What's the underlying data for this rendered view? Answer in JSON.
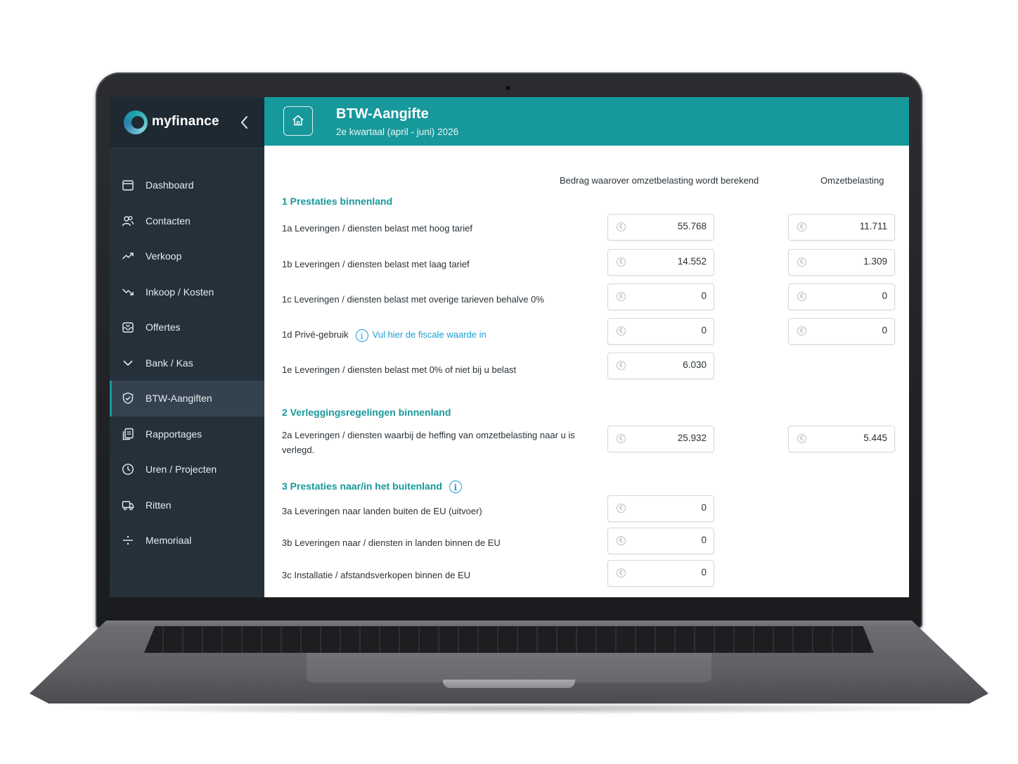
{
  "app": {
    "brand": "myfinance"
  },
  "sidebar": {
    "items": [
      {
        "label": "Dashboard",
        "icon": "calendar-icon"
      },
      {
        "label": "Contacten",
        "icon": "users-icon"
      },
      {
        "label": "Verkoop",
        "icon": "trend-up-icon"
      },
      {
        "label": "Inkoop / Kosten",
        "icon": "trend-down-icon"
      },
      {
        "label": "Offertes",
        "icon": "inbox-icon"
      },
      {
        "label": "Bank / Kas",
        "icon": "chevron-down-icon"
      },
      {
        "label": "BTW-Aangiften",
        "icon": "shield-icon",
        "active": true
      },
      {
        "label": "Rapportages",
        "icon": "documents-icon"
      },
      {
        "label": "Uren / Projecten",
        "icon": "clock-icon"
      },
      {
        "label": "Ritten",
        "icon": "truck-icon"
      },
      {
        "label": "Memoriaal",
        "icon": "divide-icon"
      }
    ]
  },
  "header": {
    "title": "BTW-Aangifte",
    "subtitle": "2e kwartaal (april - juni) 2026"
  },
  "columns": {
    "base": "Bedrag waarover omzetbelasting wordt berekend",
    "tax": "Omzetbelasting"
  },
  "sections": {
    "s1": {
      "title": "1 Prestaties binnenland",
      "r1a": {
        "label": "1a Leveringen / diensten belast met hoog tarief",
        "base": "55.768",
        "tax": "11.711"
      },
      "r1b": {
        "label": "1b Leveringen / diensten belast met laag tarief",
        "base": "14.552",
        "tax": "1.309"
      },
      "r1c": {
        "label": "1c Leveringen / diensten belast met overige tarieven behalve 0%",
        "base": "0",
        "tax": "0"
      },
      "r1d": {
        "label": "1d Privé-gebruik",
        "link": "Vul hier de fiscale waarde in",
        "base": "0",
        "tax": "0"
      },
      "r1e": {
        "label": "1e Leveringen / diensten belast met 0% of niet bij u belast",
        "base": "6.030"
      }
    },
    "s2": {
      "title": "2 Verleggingsregelingen binnenland",
      "r2a": {
        "label": "2a Leveringen / diensten waarbij de heffing van omzetbelasting naar u is verlegd.",
        "base": "25.932",
        "tax": "5.445"
      }
    },
    "s3": {
      "title": "3 Prestaties naar/in het buitenland",
      "r3a": {
        "label": "3a Leveringen naar landen buiten de EU (uitvoer)",
        "base": "0"
      },
      "r3b": {
        "label": "3b Leveringen naar / diensten in landen binnen de EU",
        "base": "0"
      },
      "r3c": {
        "label": "3c Installatie / afstandsverkopen binnen de EU",
        "base": "0"
      }
    }
  },
  "currency_symbol": "€",
  "info_symbol": "i",
  "colors": {
    "accent": "#17989b",
    "sidebar": "#24313b",
    "link": "#1a9fd2"
  }
}
